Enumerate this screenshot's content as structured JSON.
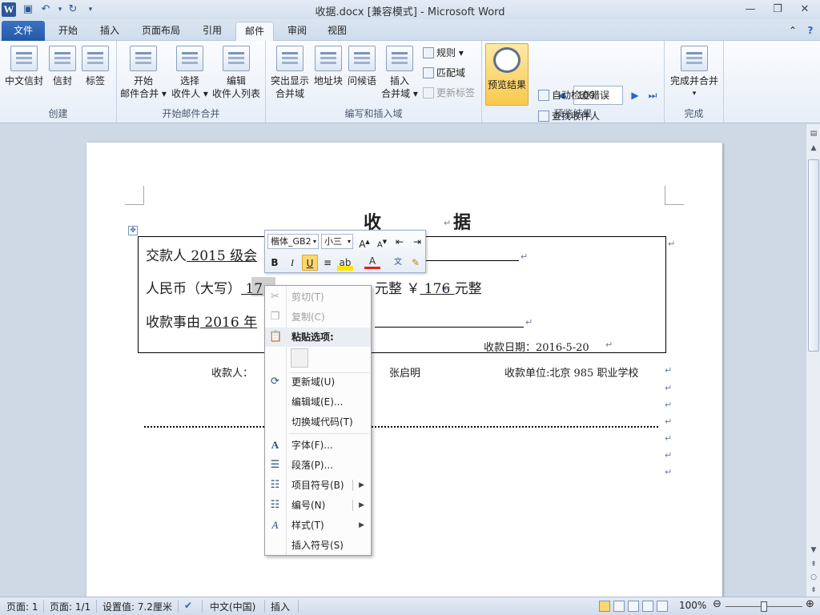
{
  "window": {
    "title": "收据.docx [兼容模式] - Microsoft Word",
    "app_icon": "W",
    "minimize": "—",
    "restore": "❐",
    "close": "✕"
  },
  "tabs": [
    "文件",
    "开始",
    "插入",
    "页面布局",
    "引用",
    "邮件",
    "审阅",
    "视图"
  ],
  "active_tab": "邮件",
  "ribbon": {
    "create": {
      "label": "创建",
      "envelope_cn": "中文信封",
      "envelope": "信封",
      "labels": "标签"
    },
    "start_merge": {
      "label": "开始邮件合并",
      "start_line1": "开始",
      "start_line2": "邮件合并 ▾",
      "select_line1": "选择",
      "select_line2": "收件人 ▾",
      "edit_line1": "编辑",
      "edit_line2": "收件人列表"
    },
    "write_insert": {
      "label": "编写和插入域",
      "highlight_line1": "突出显示",
      "highlight_line2": "合并域",
      "address_block": "地址块",
      "greeting": "问候语",
      "insert_line1": "插入",
      "insert_line2": "合并域 ▾",
      "rules": "规则 ▾",
      "match_fields": "匹配域",
      "update_labels": "更新标签"
    },
    "preview": {
      "label": "预览结果",
      "preview_results": "预览结果",
      "record_value": "100",
      "find_recipient": "查找收件人",
      "auto_check": "自动检查错误"
    },
    "finish": {
      "label": "完成",
      "finish_merge": "完成并合并",
      "finish_arrow": "▾"
    }
  },
  "document": {
    "title": "收　据",
    "line1_prefix": "交款人",
    "line1_value": " 2015 级会",
    "line2_prefix": "人民币（大写）",
    "line2_value1": " 17",
    "line2_mid": "元整  ￥",
    "line2_value2": " 176 ",
    "line2_suffix": "元整",
    "line3_prefix": "收款事由",
    "line3_value": " 2016 年",
    "date": "收款日期：2016-5-20",
    "payee": "收款人：",
    "accountant_name": "张启明",
    "unit": "收款单位:北京 985 职业学校"
  },
  "minitoolbar": {
    "font": "楷体_GB2",
    "size": "小三",
    "bold": "B",
    "italic": "I",
    "underline": "U"
  },
  "context_menu": {
    "cut": "剪切(T)",
    "copy": "复制(C)",
    "paste_options": "粘贴选项:",
    "update_field": "更新域(U)",
    "edit_field": "编辑域(E)...",
    "toggle_field_codes": "切换域代码(T)",
    "font": "字体(F)...",
    "paragraph": "段落(P)...",
    "bullets": "项目符号(B)",
    "numbering": "编号(N)",
    "styles": "样式(T)",
    "insert_symbol": "插入符号(S)"
  },
  "status": {
    "page": "页面: 1",
    "pages": "页面: 1/1",
    "setting": "设置值: 7.2厘米",
    "language": "中文(中国)",
    "insert_mode": "插入",
    "zoom": "100%"
  }
}
